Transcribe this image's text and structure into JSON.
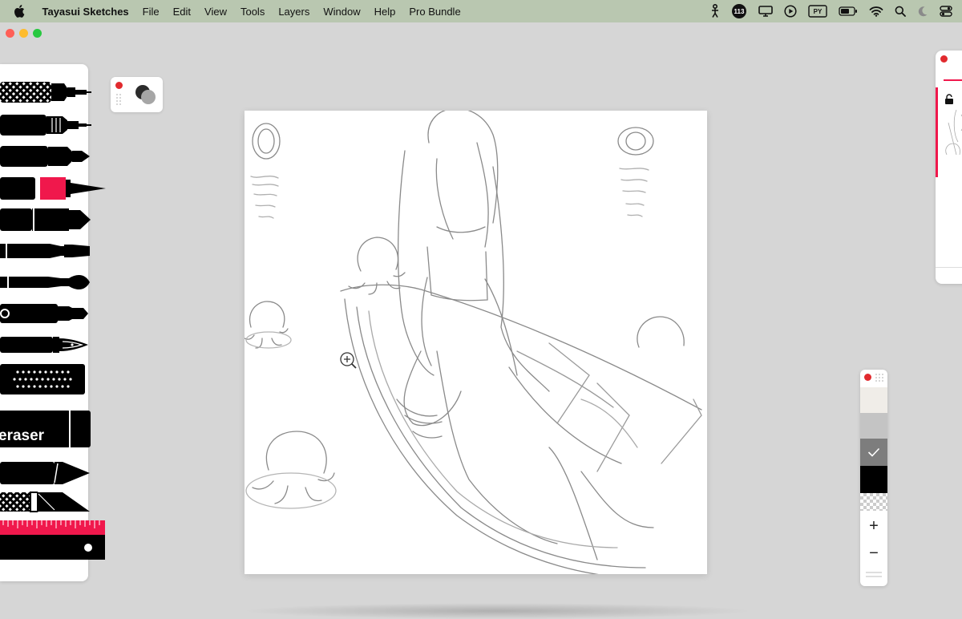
{
  "menubar": {
    "apple_icon": "apple-logo-icon",
    "items": [
      "Tayasui Sketches",
      "File",
      "Edit",
      "View",
      "Tools",
      "Layers",
      "Window",
      "Help",
      "Pro Bundle"
    ],
    "status_icons": [
      "stick-figure-icon",
      "badge-icon",
      "display-icon",
      "play-circle-icon",
      "py-icon",
      "battery-icon",
      "wifi-icon",
      "search-icon",
      "moon-icon",
      "control-center-icon"
    ],
    "badge_count": "113",
    "py_label": "PY"
  },
  "window": {
    "close_color": "#ff5f57",
    "minimize_color": "#febc2e",
    "zoom_color": "#28c840"
  },
  "toolbar": {
    "tools": [
      "fineliner",
      "technical-pen",
      "felt-pen",
      "brush-pen",
      "marker",
      "paint-brush",
      "watercolor-brush",
      "pencil",
      "fountain-pen",
      "spray",
      "eraser",
      "crayon",
      "cutter",
      "ruler"
    ],
    "eraser_label": "eraser"
  },
  "colors": {
    "accent": "#f0184c",
    "current_color": "#2b2b2b",
    "secondary_color": "#a6a6a6"
  },
  "palette": {
    "swatches": [
      "#f0ede8",
      "#c4c4c4",
      "#7d7d7d",
      "#000000",
      "transparent"
    ],
    "selected_index": 2,
    "add_label": "+",
    "remove_label": "−"
  },
  "canvas": {
    "cursor_icon": "zoom-plus-icon"
  }
}
